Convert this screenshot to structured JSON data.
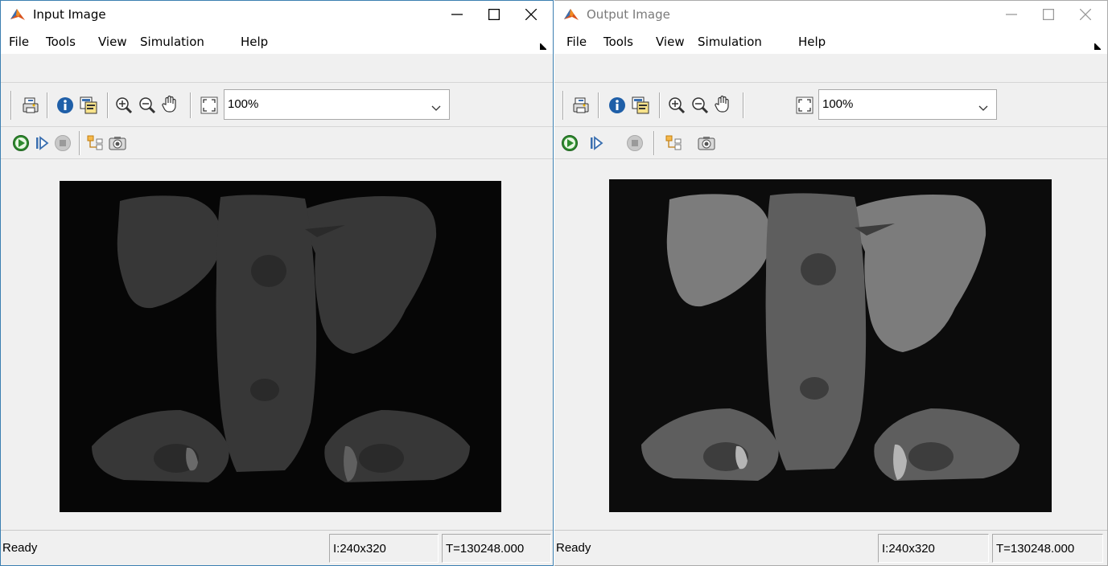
{
  "windows": [
    {
      "title": "Input Image",
      "menu": [
        "File",
        "Tools",
        "View",
        "Simulation",
        "Help"
      ],
      "zoom": "100%",
      "status": {
        "state": "Ready",
        "size": "I:240x320",
        "time": "T=130248.000"
      },
      "active": true
    },
    {
      "title": "Output Image",
      "menu": [
        "File",
        "Tools",
        "View",
        "Simulation",
        "Help"
      ],
      "zoom": "100%",
      "status": {
        "state": "Ready",
        "size": "I:240x320",
        "time": "T=130248.000"
      },
      "active": false
    }
  ],
  "icons": {
    "app": "matlab-icon",
    "toolbar1": [
      "print-icon",
      "info-icon",
      "properties-icon",
      "zoom-in-icon",
      "zoom-out-icon",
      "pan-hand-icon",
      "fit-to-window-icon"
    ],
    "toolbar2": [
      "run-icon",
      "step-forward-icon",
      "stop-icon",
      "highlight-block-icon",
      "snapshot-icon"
    ]
  },
  "colors": {
    "active_border": "#3c7fb1",
    "run_green": "#2e8b2e"
  }
}
